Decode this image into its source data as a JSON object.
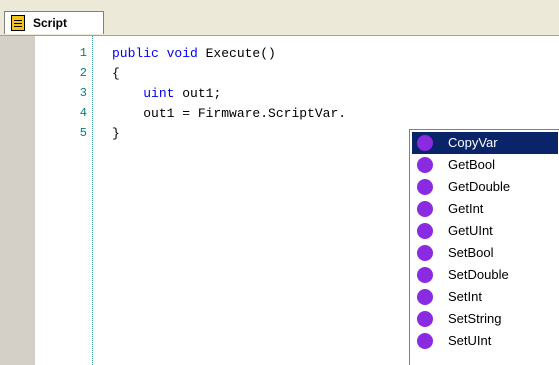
{
  "tab": {
    "label": "Script",
    "icon": "script-icon"
  },
  "editor": {
    "lines": [
      {
        "num": "1",
        "kw": "public void ",
        "text": "Execute()",
        "indent": ""
      },
      {
        "num": "2",
        "kw": "",
        "text": "{",
        "indent": ""
      },
      {
        "num": "3",
        "kw": "uint ",
        "text": "out1;",
        "indent": "    "
      },
      {
        "num": "4",
        "kw": "",
        "text": "out1 = Firmware.ScriptVar.",
        "indent": "    "
      },
      {
        "num": "5",
        "kw": "",
        "text": "}",
        "indent": ""
      }
    ]
  },
  "autocomplete": {
    "selected_index": 0,
    "icon": "method-icon",
    "items": [
      "CopyVar",
      "GetBool",
      "GetDouble",
      "GetInt",
      "GetUInt",
      "SetBool",
      "SetDouble",
      "SetInt",
      "SetString",
      "SetUInt"
    ]
  },
  "colors": {
    "keyword": "#0000ff",
    "line_number": "#008080",
    "selection": "#0a246a",
    "method_icon": "#8a2be2"
  }
}
